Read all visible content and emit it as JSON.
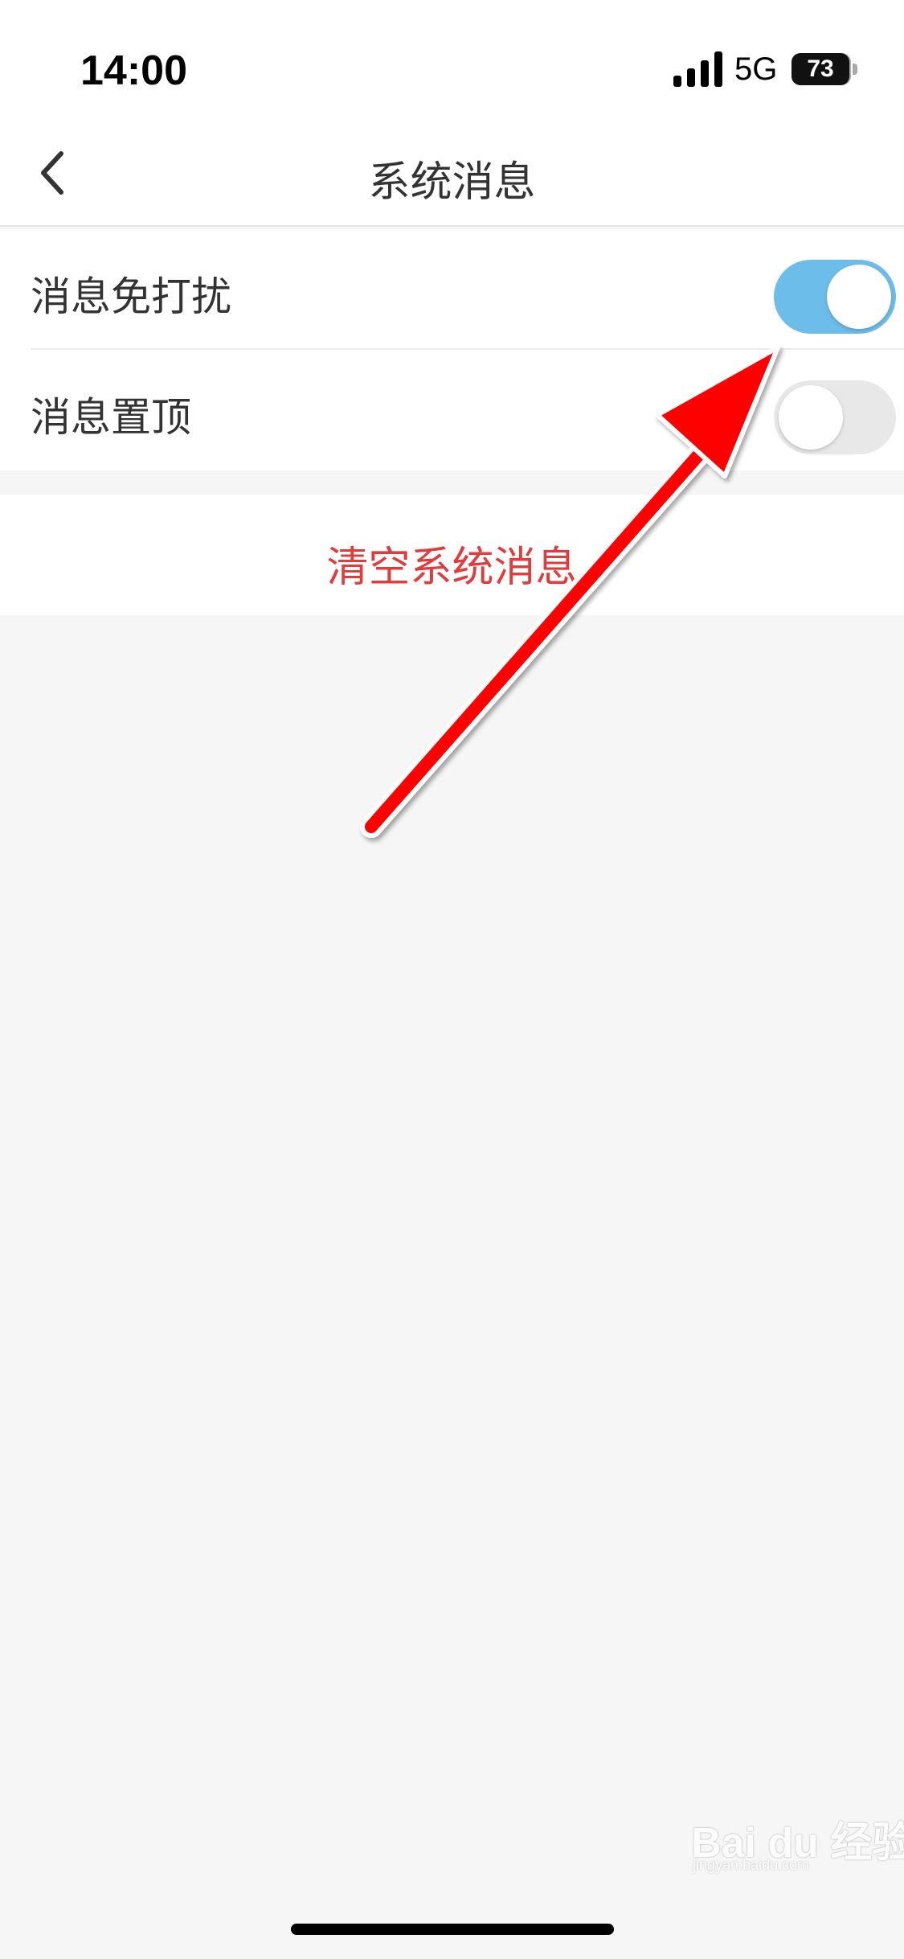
{
  "status_bar": {
    "time": "14:00",
    "network": "5G",
    "battery": "73",
    "signal_icon": "cellular-signal-icon",
    "battery_icon": "battery-icon"
  },
  "nav": {
    "title": "系统消息",
    "back_icon": "chevron-left-icon"
  },
  "settings": [
    {
      "label": "消息免打扰",
      "enabled": true
    },
    {
      "label": "消息置顶",
      "enabled": false
    }
  ],
  "clear_action": {
    "label": "清空系统消息",
    "color": "#e03c3c"
  },
  "colors": {
    "toggle_on": "#6dbdea",
    "toggle_off": "#e8e8e8",
    "annotation_arrow": "#ff0000",
    "background": "#f6f6f6"
  },
  "watermark": {
    "text": "Bai du 经验",
    "sub": "jingyan.baidu.com"
  }
}
